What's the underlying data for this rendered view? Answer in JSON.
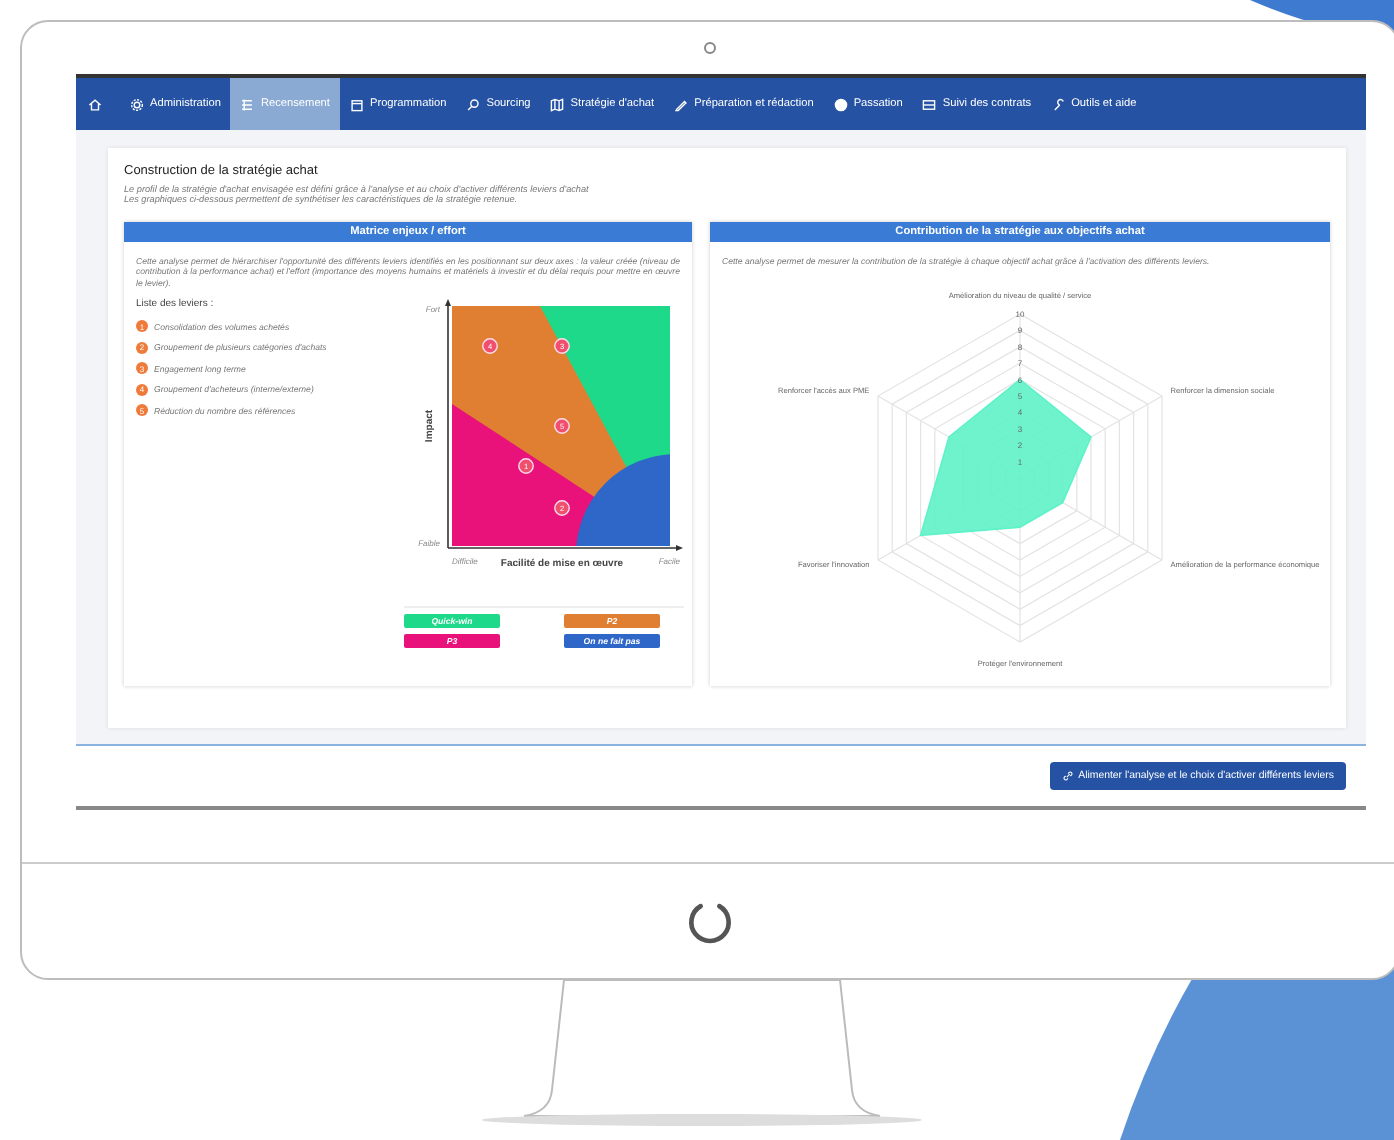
{
  "nav": {
    "items": [
      {
        "label": "Administration",
        "selected": false
      },
      {
        "label": "Recensement",
        "selected": true
      },
      {
        "label": "Programmation",
        "selected": false
      },
      {
        "label": "Sourcing",
        "selected": false
      },
      {
        "label": "Stratégie d'achat",
        "selected": false
      },
      {
        "label": "Préparation et rédaction",
        "selected": false
      },
      {
        "label": "Passation",
        "selected": false
      },
      {
        "label": "Suivi des contrats",
        "selected": false
      },
      {
        "label": "Outils et aide",
        "selected": false
      }
    ]
  },
  "card": {
    "title": "Construction de la stratégie achat",
    "subtitle": [
      "Le profil de la stratégie d'achat envisagée est défini grâce à l'analyse et au choix d'activer différents leviers d'achat",
      "Les graphiques ci-dessous permettent de synthétiser les caractéristiques de la stratégie retenue."
    ]
  },
  "matrix_panel": {
    "title": "Matrice enjeux / effort",
    "description": "Cette analyse permet de hiérarchiser l'opportunité des différents leviers identifiés en les positionnant sur deux axes : la valeur créée (niveau de contribution à la performance achat) et l'effort (importance des moyens humains et matériels à investir et du délai requis pour mettre en œuvre le levier).",
    "levers_title": "Liste des leviers :",
    "levers": [
      {
        "number": "1",
        "label": "Consolidation des volumes achetés"
      },
      {
        "number": "2",
        "label": "Groupement de plusieurs catégories d'achats"
      },
      {
        "number": "3",
        "label": "Engagement long terme"
      },
      {
        "number": "4",
        "label": "Groupement d'acheteurs (interne/externe)"
      },
      {
        "number": "5",
        "label": "Réduction du nombre des références"
      }
    ],
    "y_high": "Fort",
    "y_label": "Impact",
    "y_low": "Faible",
    "x_low": "Difficile",
    "x_label": "Facilité de mise en œuvre",
    "x_high": "Facile",
    "points": [
      {
        "label": "4"
      },
      {
        "label": "3"
      },
      {
        "label": "5"
      },
      {
        "label": "1"
      },
      {
        "label": "2"
      }
    ],
    "legend": [
      {
        "label": "Quick-win",
        "color": "#1fd98a"
      },
      {
        "label": "P2",
        "color": "#e07f32"
      },
      {
        "label": "P3",
        "color": "#e8127a"
      },
      {
        "label": "On ne fait pas",
        "color": "#2f67c9"
      }
    ]
  },
  "radar_panel": {
    "title": "Contribution de la stratégie aux objectifs achat",
    "description": "Cette analyse permet de mesurer la contribution de la stratégie à chaque objectif achat grâce à l'activation des différents leviers.",
    "radar": {
      "axis_labels": [
        "Amélioration du niveau de qualité / service",
        "Renforcer l'accès aux PME",
        "Renforcer la dimension sociale",
        "Favoriser l'innovation",
        "Amélioration de la performance économique",
        "Protéger l'environnement"
      ],
      "tick_labels": [
        "10",
        "9",
        "8",
        "7",
        "6",
        "5",
        "4",
        "3",
        "2",
        "1"
      ]
    }
  },
  "footer": {
    "button": "Alimenter l'analyse et le choix d'activer différents leviers"
  }
}
